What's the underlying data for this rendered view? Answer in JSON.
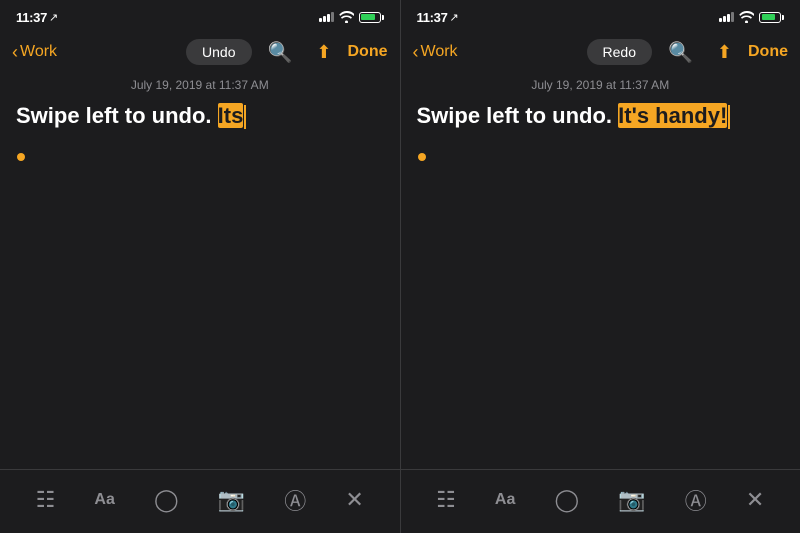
{
  "screen_left": {
    "status_bar": {
      "time": "11:37",
      "location_arrow": "↑",
      "battery_level": 85
    },
    "toolbar": {
      "back_label": "Work",
      "undo_label": "Undo",
      "done_label": "Done"
    },
    "note_date": "July 19, 2019 at 11:37 AM",
    "note_text_before": "Swipe left to undo. Its",
    "note_highlighted": "Its",
    "cursor_visible": true,
    "bottom_icons": [
      "table-icon",
      "text-icon",
      "check-icon",
      "camera-icon",
      "pen-icon",
      "close-icon"
    ]
  },
  "screen_right": {
    "status_bar": {
      "time": "11:37",
      "location_arrow": "↑",
      "battery_level": 85
    },
    "toolbar": {
      "back_label": "Work",
      "redo_label": "Redo",
      "done_label": "Done"
    },
    "note_date": "July 19, 2019 at 11:37 AM",
    "note_text_before": "Swipe left to undo. ",
    "note_highlighted": "It's handy!",
    "cursor_visible": true,
    "bottom_icons": [
      "table-icon",
      "text-icon",
      "check-icon",
      "camera-icon",
      "pen-icon",
      "close-icon"
    ]
  }
}
